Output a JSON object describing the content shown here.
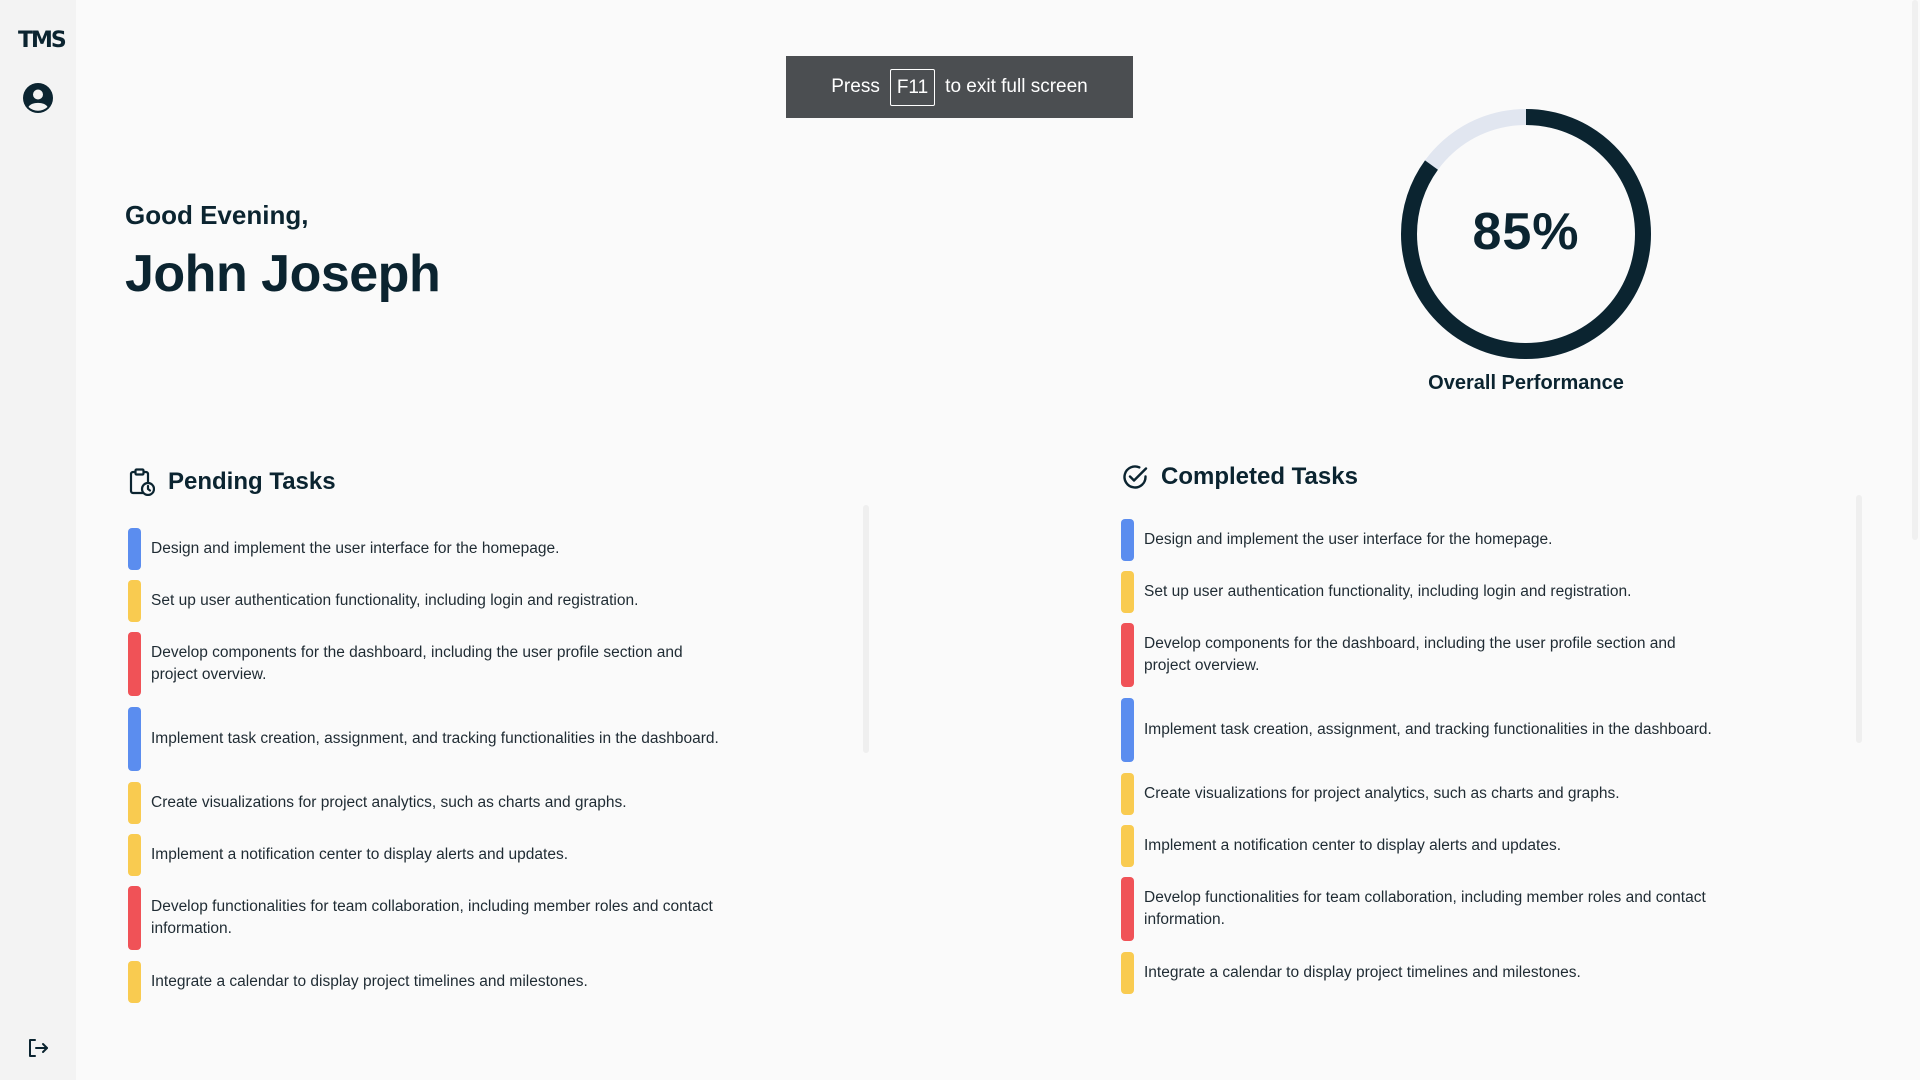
{
  "app": {
    "logo_text": "TMS"
  },
  "toast": {
    "prefix": "Press",
    "key": "F11",
    "suffix": "to exit full screen"
  },
  "greeting": "Good Evening,",
  "user_name": "John Joseph",
  "performance": {
    "value_text": "85%",
    "value": 85,
    "label": "Overall Performance"
  },
  "colors": {
    "blue": "#5b8def",
    "yellow": "#f9cb50",
    "red": "#f05257",
    "ring": "#0b2430",
    "ring_track": "#e1e6f0"
  },
  "pending": {
    "title": "Pending Tasks",
    "tasks": [
      {
        "text": "Design and implement the user interface for the homepage.",
        "color": "blue"
      },
      {
        "text": "Set up user authentication functionality, including login and registration.",
        "color": "yellow"
      },
      {
        "text": "Develop components for the dashboard, including the user profile section and project overview.",
        "color": "red"
      },
      {
        "text": "Implement task creation, assignment, and tracking functionalities in the dashboard.",
        "color": "blue"
      },
      {
        "text": "Create visualizations for project analytics, such as charts and graphs.",
        "color": "yellow"
      },
      {
        "text": "Implement a notification center to display alerts and updates.",
        "color": "yellow"
      },
      {
        "text": "Develop functionalities for team collaboration, including member roles and contact information.",
        "color": "red"
      },
      {
        "text": "Integrate a calendar to display project timelines and milestones.",
        "color": "yellow"
      }
    ]
  },
  "completed": {
    "title": "Completed Tasks",
    "tasks": [
      {
        "text": "Design and implement the user interface for the homepage.",
        "color": "blue"
      },
      {
        "text": "Set up user authentication functionality, including login and registration.",
        "color": "yellow"
      },
      {
        "text": "Develop components for the dashboard, including the user profile section and project overview.",
        "color": "red"
      },
      {
        "text": "Implement task creation, assignment, and tracking functionalities in the dashboard.",
        "color": "blue"
      },
      {
        "text": "Create visualizations for project analytics, such as charts and graphs.",
        "color": "yellow"
      },
      {
        "text": "Implement a notification center to display alerts and updates.",
        "color": "yellow"
      },
      {
        "text": "Develop functionalities for team collaboration, including member roles and contact information.",
        "color": "red"
      },
      {
        "text": "Integrate a calendar to display project timelines and milestones.",
        "color": "yellow"
      }
    ]
  }
}
